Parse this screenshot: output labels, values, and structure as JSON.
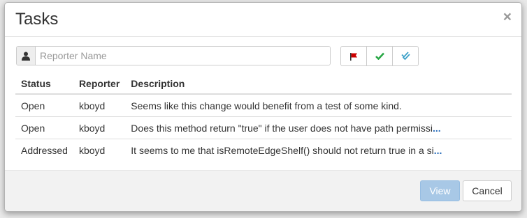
{
  "dialog": {
    "title": "Tasks",
    "close_label": "×"
  },
  "filter": {
    "placeholder": "Reporter Name"
  },
  "filter_buttons": [
    {
      "name": "flag",
      "color": "#cc0000"
    },
    {
      "name": "check",
      "color": "#28a745"
    },
    {
      "name": "double-check",
      "color": "#3aa0c8"
    }
  ],
  "table": {
    "headers": {
      "status": "Status",
      "reporter": "Reporter",
      "description": "Description"
    },
    "rows": [
      {
        "status": "Open",
        "reporter": "kboyd",
        "description": "Seems like this change would benefit from a test of some kind.",
        "more": ""
      },
      {
        "status": "Open",
        "reporter": "kboyd",
        "description": "Does this method return \"true\" if the user does not have path permissi",
        "more": "..."
      },
      {
        "status": "Addressed",
        "reporter": "kboyd",
        "description": "It seems to me that isRemoteEdgeShelf() should not return true in a si",
        "more": "..."
      }
    ]
  },
  "footer": {
    "view_label": "View",
    "cancel_label": "Cancel"
  }
}
